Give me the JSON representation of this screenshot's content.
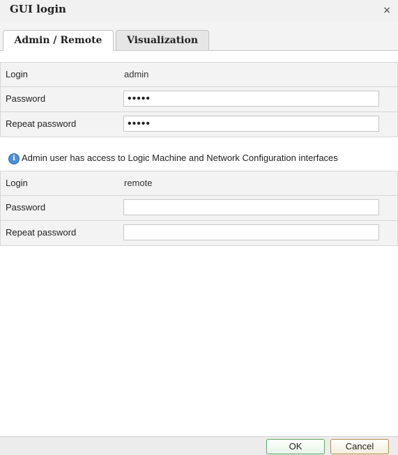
{
  "window": {
    "title": "GUI login",
    "close_symbol": "×"
  },
  "tabs": [
    {
      "label": "Admin / Remote",
      "active": true
    },
    {
      "label": "Visualization",
      "active": false
    }
  ],
  "admin": {
    "login_label": "Login",
    "login_value": "admin",
    "password_label": "Password",
    "password_value": "•••••",
    "repeat_label": "Repeat password",
    "repeat_value": "•••••"
  },
  "info": {
    "icon": "info-icon",
    "text": "Admin user has access to Logic Machine and Network Configuration interfaces"
  },
  "remote": {
    "login_label": "Login",
    "login_value": "remote",
    "password_label": "Password",
    "password_value": "",
    "repeat_label": "Repeat password",
    "repeat_value": ""
  },
  "footer": {
    "ok_label": "OK",
    "cancel_label": "Cancel"
  },
  "colors": {
    "ok_border": "#5aa85a",
    "cancel_border": "#b38a4a",
    "info_blue": "#4a90d9"
  }
}
